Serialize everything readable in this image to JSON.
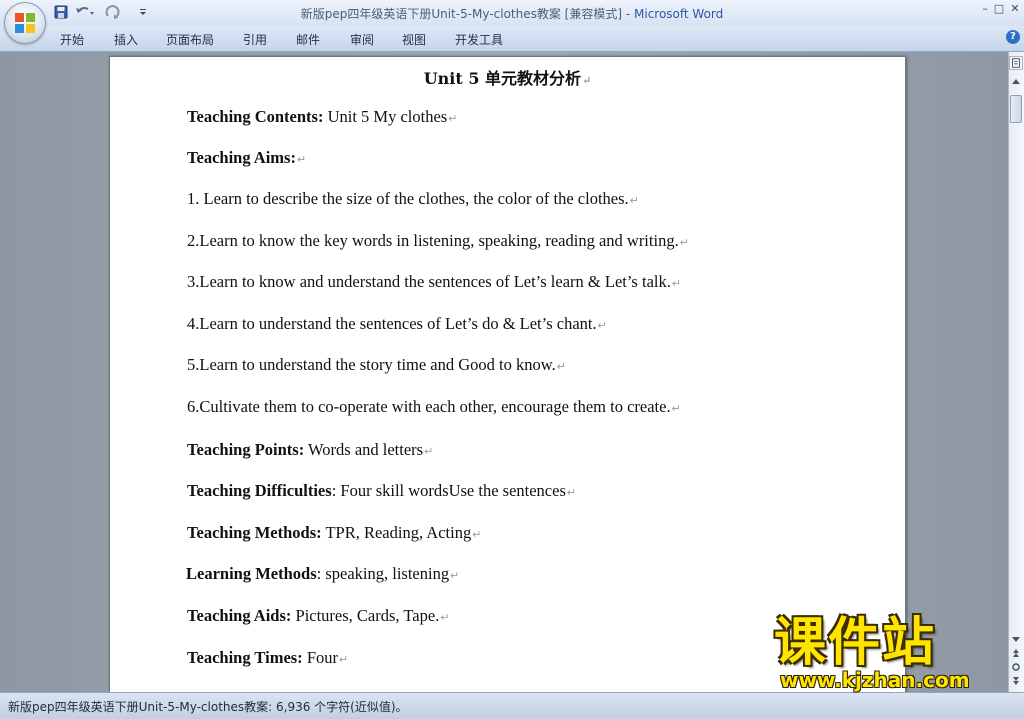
{
  "window": {
    "title_prefix": "新版pep四年级英语下册Unit-5-My-clothes教案 [兼容模式] - ",
    "title_app": "Microsoft Word",
    "minimize_glyph": "–",
    "maximize_glyph": "□",
    "close_glyph": "✕"
  },
  "ribbon": {
    "tabs": [
      "开始",
      "插入",
      "页面布局",
      "引用",
      "邮件",
      "审阅",
      "视图",
      "开发工具"
    ],
    "help_glyph": "?"
  },
  "document": {
    "title": "Unit 5 单元教材分析",
    "paragraph_mark": "↵",
    "paragraphs": [
      {
        "label": "Teaching Contents:",
        "text": " Unit 5 My clothes"
      },
      {
        "label": "Teaching Aims:",
        "text": ""
      },
      {
        "label": "",
        "text": "1. Learn to describe the size of the clothes, the color of the clothes."
      },
      {
        "label": "",
        "text": "2.Learn to know the key words in listening, speaking, reading and writing."
      },
      {
        "label": "",
        "text": "3.Learn to know and understand the sentences of Let’s learn & Let’s talk."
      },
      {
        "label": "",
        "text": "4.Learn to understand the sentences of Let’s do & Let’s chant."
      },
      {
        "label": "",
        "text": "5.Learn to understand the story time and Good to know."
      },
      {
        "label": "",
        "text": "6.Cultivate them to co-operate with each other, encourage them to create."
      },
      {
        "label": "Teaching Points:",
        "text": " Words and letters"
      },
      {
        "label": "Teaching Difficulties",
        "text": ": Four skill wordsUse the sentences"
      },
      {
        "label": "Teaching Methods:",
        "text": " TPR, Reading, Acting"
      },
      {
        "label": "Learning Methods",
        "text": ": speaking, listening"
      },
      {
        "label": "Teaching Aids:",
        "text": " Pictures, Cards, Tape."
      },
      {
        "label": "Teaching Times:",
        "text": " Four"
      }
    ]
  },
  "status": {
    "text": "新版pep四年级英语下册Unit-5-My-clothes教案: 6,936 个字符(近似值)。"
  },
  "watermark": {
    "brand": "课件站",
    "url": "www.kjzhan.com"
  },
  "colors": {
    "title_app": "#2b57a5",
    "watermark": "#ffe400"
  }
}
